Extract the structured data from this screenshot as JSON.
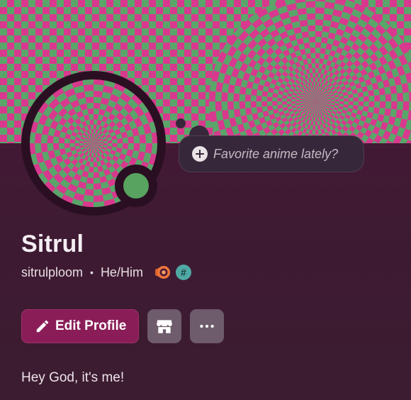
{
  "profile": {
    "display_name": "Sitrul",
    "username": "sitrulploom",
    "separator": "•",
    "pronouns": "He/Him",
    "bio": "Hey God, it's me!",
    "online_status": "online",
    "status_color": "#57a35f"
  },
  "status_bubble": {
    "placeholder": "Favorite anime lately?",
    "icon": "plus-circle-icon"
  },
  "badges": [
    {
      "name": "nitro-boost-badge",
      "color": "#f0763c"
    },
    {
      "name": "hashtag-badge",
      "glyph": "#",
      "color": "#4fa9a4"
    }
  ],
  "actions": {
    "edit_profile_label": "Edit Profile",
    "shop_icon": "shop-icon",
    "more_icon": "more-horizontal-icon"
  },
  "colors": {
    "banner_pink": "#d8398e",
    "banner_green": "#5aa56a",
    "accent_button": "#8a1d57",
    "card_background": "#4a1736"
  }
}
